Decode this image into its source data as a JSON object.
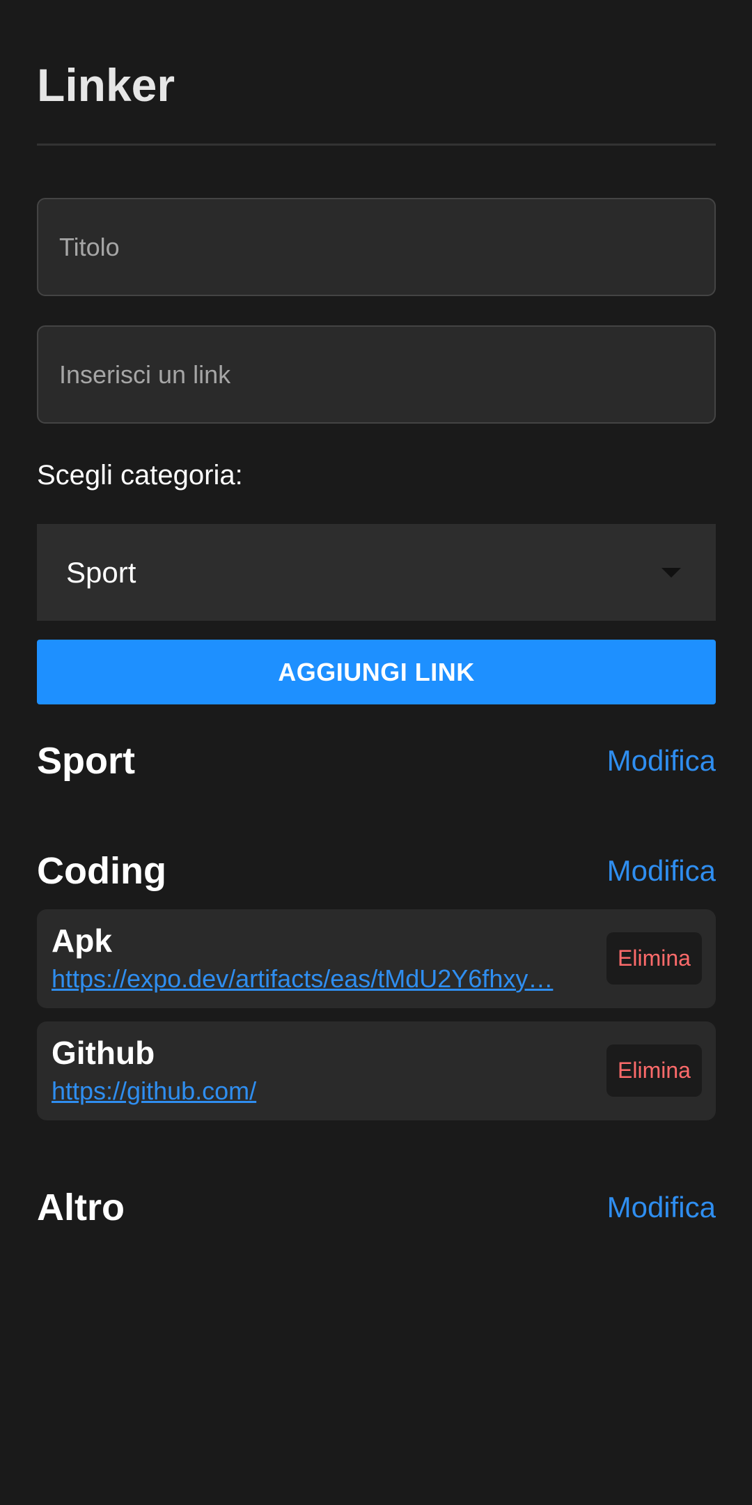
{
  "header": {
    "title": "Linker"
  },
  "form": {
    "title_placeholder": "Titolo",
    "link_placeholder": "Inserisci un link",
    "category_label": "Scegli categoria:",
    "category_selected": "Sport",
    "add_button_label": "AGGIUNGI LINK"
  },
  "categories": [
    {
      "name": "Sport",
      "edit_label": "Modifica",
      "links": []
    },
    {
      "name": "Coding",
      "edit_label": "Modifica",
      "links": [
        {
          "title": "Apk",
          "url": "https://expo.dev/artifacts/eas/tMdU2Y6fhxy…",
          "delete_label": "Elimina"
        },
        {
          "title": "Github",
          "url": "https://github.com/",
          "delete_label": "Elimina"
        }
      ]
    },
    {
      "name": "Altro",
      "edit_label": "Modifica",
      "links": []
    }
  ],
  "colors": {
    "background": "#1a1a1a",
    "accent": "#1e90ff",
    "link": "#2f8ef0",
    "danger": "#ff6b6b"
  }
}
